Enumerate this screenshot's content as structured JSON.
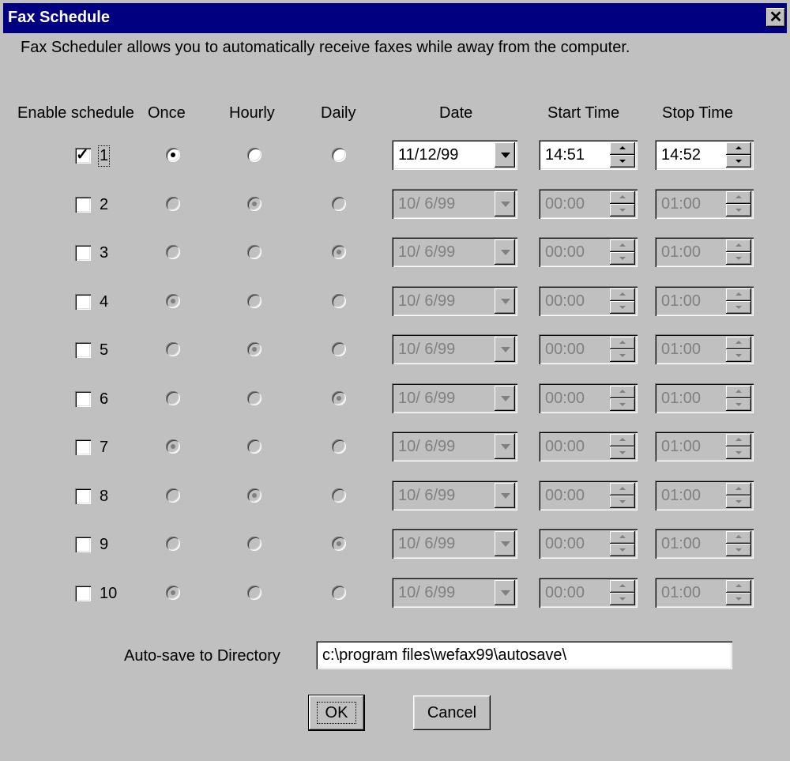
{
  "window": {
    "title": "Fax Schedule",
    "close_glyph": "✕"
  },
  "description": "Fax Scheduler allows you to automatically receive faxes while away from the computer.",
  "headers": {
    "enable": "Enable schedule",
    "once": "Once",
    "hourly": "Hourly",
    "daily": "Daily",
    "date": "Date",
    "start": "Start Time",
    "stop": "Stop Time"
  },
  "schedules": [
    {
      "num": "1",
      "enabled": true,
      "freq": "once",
      "date": "11/12/99",
      "start": "14:51",
      "stop": "14:52"
    },
    {
      "num": "2",
      "enabled": false,
      "freq": "hourly",
      "date": "10/ 6/99",
      "start": "00:00",
      "stop": "01:00"
    },
    {
      "num": "3",
      "enabled": false,
      "freq": "daily",
      "date": "10/ 6/99",
      "start": "00:00",
      "stop": "01:00"
    },
    {
      "num": "4",
      "enabled": false,
      "freq": "once",
      "date": "10/ 6/99",
      "start": "00:00",
      "stop": "01:00"
    },
    {
      "num": "5",
      "enabled": false,
      "freq": "hourly",
      "date": "10/ 6/99",
      "start": "00:00",
      "stop": "01:00"
    },
    {
      "num": "6",
      "enabled": false,
      "freq": "daily",
      "date": "10/ 6/99",
      "start": "00:00",
      "stop": "01:00"
    },
    {
      "num": "7",
      "enabled": false,
      "freq": "once",
      "date": "10/ 6/99",
      "start": "00:00",
      "stop": "01:00"
    },
    {
      "num": "8",
      "enabled": false,
      "freq": "hourly",
      "date": "10/ 6/99",
      "start": "00:00",
      "stop": "01:00"
    },
    {
      "num": "9",
      "enabled": false,
      "freq": "daily",
      "date": "10/ 6/99",
      "start": "00:00",
      "stop": "01:00"
    },
    {
      "num": "10",
      "enabled": false,
      "freq": "once",
      "date": "10/ 6/99",
      "start": "00:00",
      "stop": "01:00"
    }
  ],
  "autosave": {
    "label": "Auto-save to Directory",
    "value": "c:\\program files\\wefax99\\autosave\\"
  },
  "buttons": {
    "ok": "OK",
    "cancel": "Cancel"
  },
  "colors": {
    "title_bar": "#000080",
    "face": "#c0c0c0",
    "disabled_text": "#808080"
  }
}
